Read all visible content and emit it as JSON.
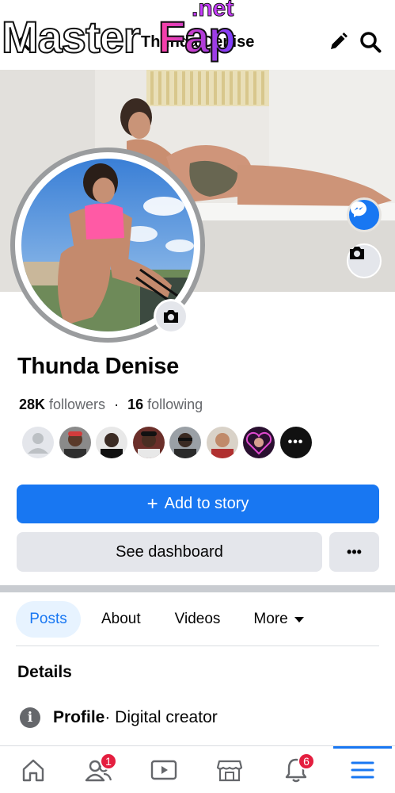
{
  "header": {
    "title": "Thunda Denise",
    "watermark": {
      "part1": "Master",
      "part2": "Fap",
      "part3": ".net"
    }
  },
  "profile": {
    "name": "Thunda Denise",
    "followers_count": "28K",
    "followers_label": "followers",
    "following_count": "16",
    "following_label": "following",
    "friends_more": "•••"
  },
  "buttons": {
    "add_story": "Add to story",
    "see_dashboard": "See dashboard",
    "more": "•••"
  },
  "tabs": [
    {
      "label": "Posts",
      "active": true
    },
    {
      "label": "About",
      "active": false
    },
    {
      "label": "Videos",
      "active": false
    },
    {
      "label": "More",
      "active": false
    }
  ],
  "details": {
    "title": "Details",
    "row_label": "Profile",
    "row_value": " · Digital creator"
  },
  "bottom_nav": {
    "items": [
      "home-icon",
      "friends-icon",
      "video-icon",
      "marketplace-icon",
      "bell-icon",
      "menu-icon"
    ],
    "friends_badge": "1",
    "notifications_badge": "6"
  },
  "colors": {
    "accent": "#1877f2",
    "badge": "#e41e3f",
    "secondary_button": "#e4e6eb"
  }
}
